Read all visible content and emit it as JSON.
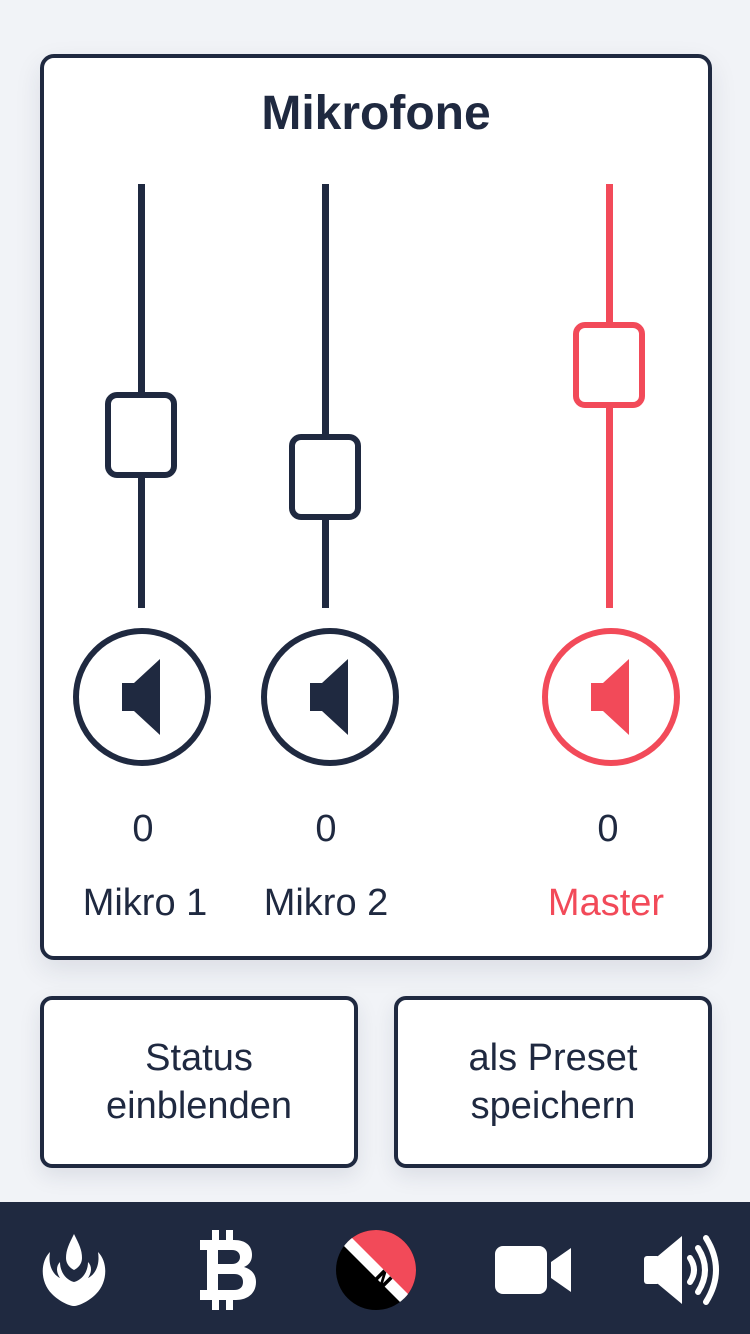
{
  "card": {
    "title": "Mikrofone",
    "channels": [
      {
        "label": "Mikro 1",
        "value": "0",
        "level": 0.56,
        "active": false
      },
      {
        "label": "Mikro 2",
        "value": "0",
        "level": 0.46,
        "active": false
      },
      {
        "label": "Master",
        "value": "0",
        "level": 0.72,
        "active": true
      }
    ]
  },
  "buttons": {
    "status": {
      "line1": "Status",
      "line2": "einblenden"
    },
    "preset": {
      "line1": "als Preset",
      "line2": "speichern"
    }
  },
  "nav": {
    "items": [
      {
        "icon": "rebel-alliance-icon"
      },
      {
        "icon": "bitcoin-icon"
      },
      {
        "icon": "nitrado-logo-icon"
      },
      {
        "icon": "video-camera-icon"
      },
      {
        "icon": "volume-icon"
      }
    ]
  },
  "colors": {
    "primary": "#1f2940",
    "accent": "#f24a59",
    "background": "#f1f3f7"
  }
}
